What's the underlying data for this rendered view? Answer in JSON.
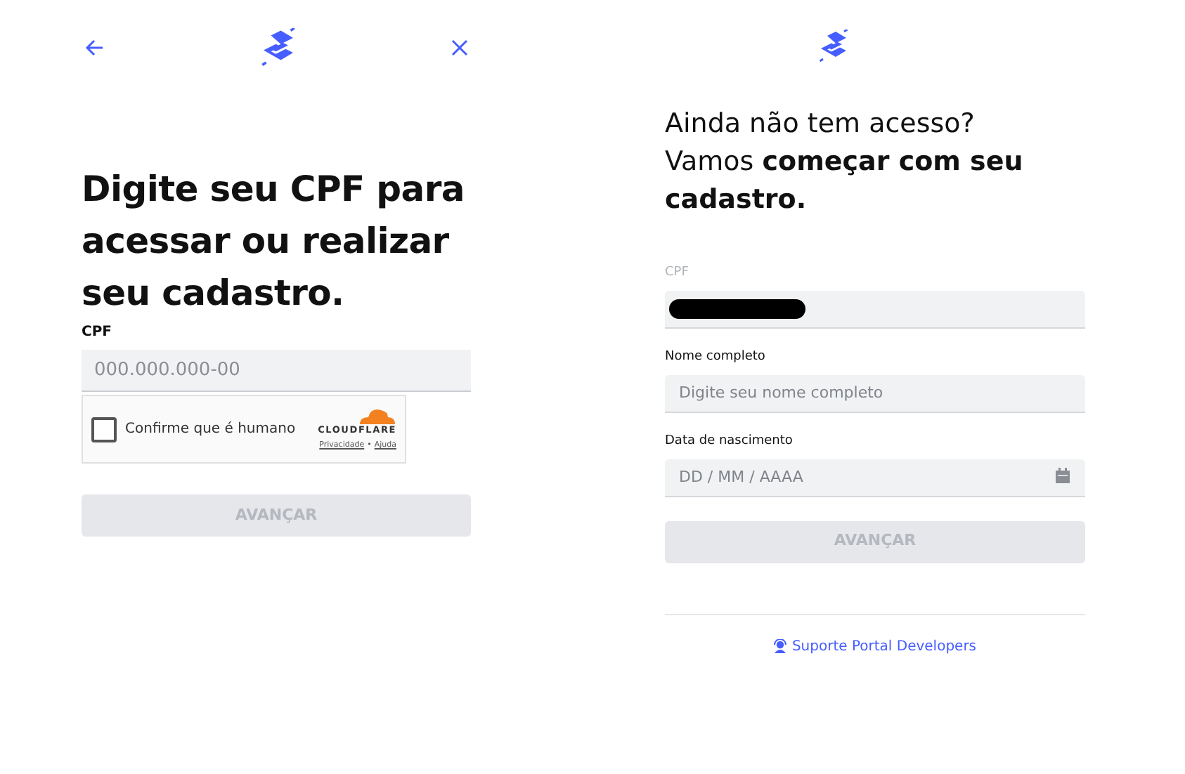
{
  "login": {
    "title": "Digite seu CPF para acessar ou realizar seu cadastro.",
    "cpf_label": "CPF",
    "cpf_placeholder": "000.000.000-00",
    "captcha": {
      "label": "Confirme que é humano",
      "checked": false,
      "brand": "CLOUDFLARE",
      "links": [
        "Privacidade",
        "Ajuda"
      ],
      "separator": "•"
    },
    "submit": {
      "label": "AVANÇAR",
      "disabled": true
    }
  },
  "signup": {
    "heading_line": "Ainda não tem acesso?",
    "heading_rest": "Vamos **começar com seu cadastro.**",
    "fields": [
      {
        "label": "CPF",
        "kind": "text",
        "redacted": true,
        "disabled": true
      },
      {
        "label": "Nome completo",
        "kind": "text",
        "placeholder": "Digite seu nome completo",
        "redacted": false,
        "disabled": false
      },
      {
        "label": "Data de nascimento",
        "kind": "date",
        "placeholder": "DD / MM / AAAA",
        "redacted": false,
        "disabled": false
      }
    ],
    "submit": {
      "label": "AVANÇAR",
      "disabled": true
    },
    "support_link": "Suporte Portal Developers"
  }
}
